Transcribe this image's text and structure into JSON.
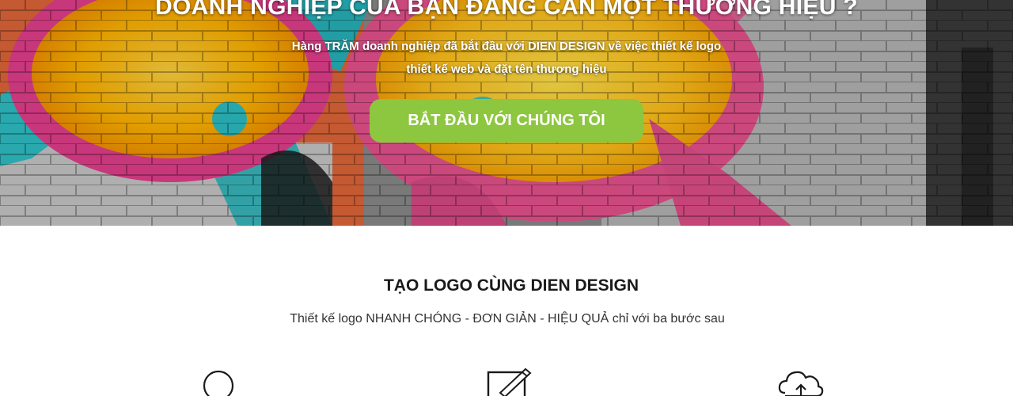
{
  "hero": {
    "title": "DOANH NGHIỆP CỦA BẠN ĐANG CẦN MỘT THƯƠNG HIỆU ?",
    "subtitle_line1": "Hàng TRĂM doanh nghiệp đã bắt đầu với DIEN DESIGN về việc thiết kế logo",
    "subtitle_line2": "thiết kế web và đặt tên thương hiệu",
    "cta_label": "BẮT ĐẦU VỚI CHÚNG TÔI",
    "background_image": "graffiti-wall-image"
  },
  "steps_section": {
    "title": "TẠO LOGO CÙNG DIEN DESIGN",
    "subtitle": "Thiết kế logo NHANH CHÓNG - ĐƠN GIẢN - HIỆU QUẢ chỉ với ba bước sau",
    "icons": [
      "search-icon",
      "edit-icon",
      "cloud-upload-icon"
    ]
  },
  "colors": {
    "accent": "#8dc63f",
    "hero_text": "#ffffff",
    "heading": "#1a1a1a"
  }
}
